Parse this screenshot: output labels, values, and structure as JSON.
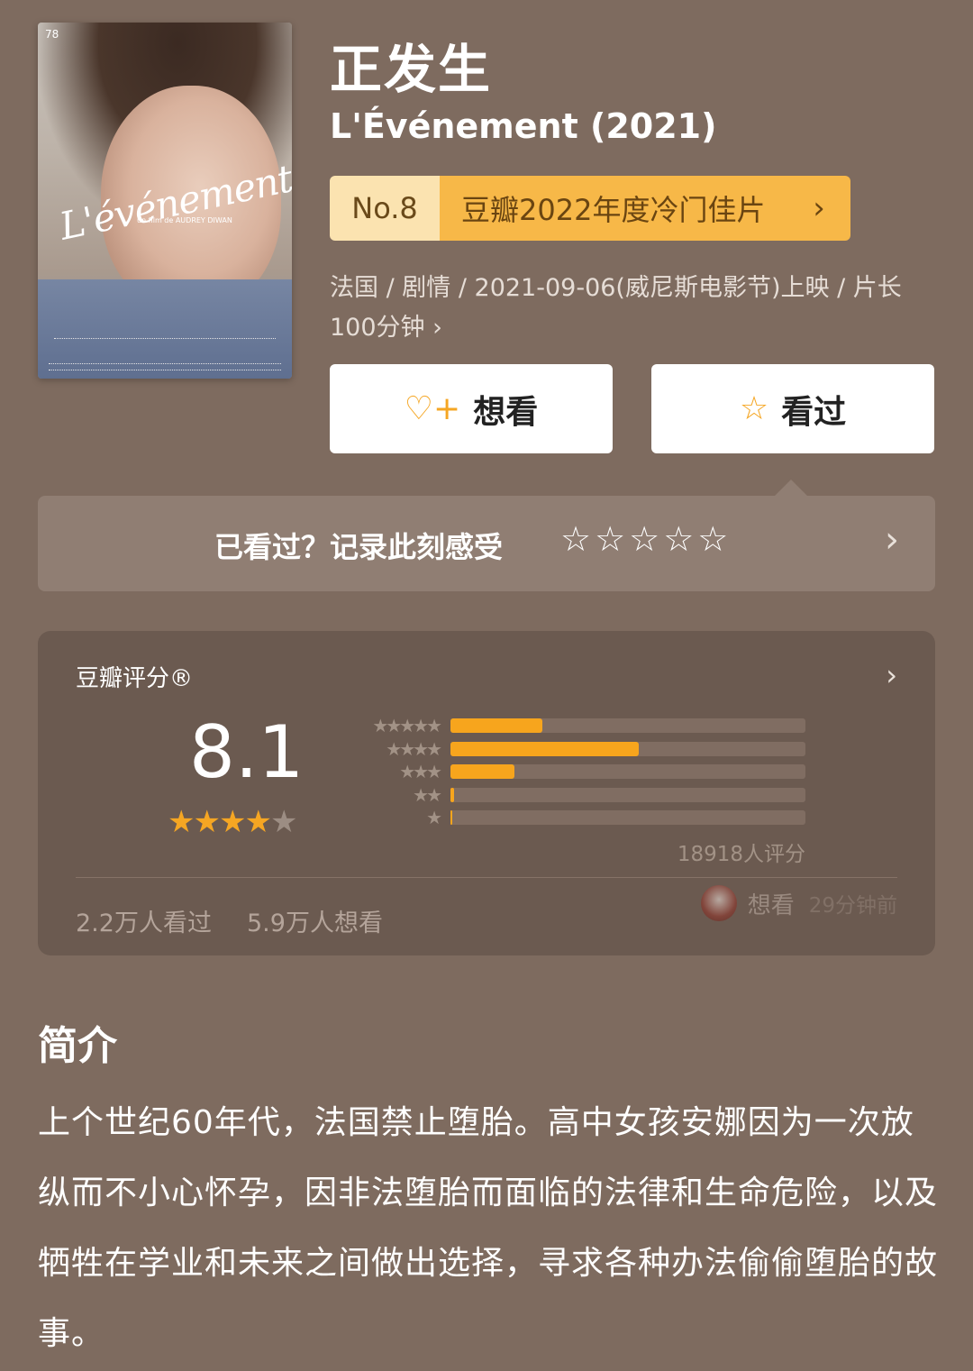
{
  "movie": {
    "title_cn": "正发生",
    "title_en": "L'Événement (2021)",
    "poster": {
      "script_title": "L'événement",
      "director_line": "un film de AUDREY DIWAN",
      "festival_mark": "78"
    },
    "rank": {
      "no": "No.8",
      "label": "豆瓣2022年度冷门佳片",
      "chevron": "›"
    },
    "meta_line1": "法国 / 剧情 / 2021-09-06(威尼斯电影节)上映 / 片长",
    "meta_line2": "100分钟 ›"
  },
  "actions": {
    "want": {
      "label": "想看",
      "icon": "heart-plus-icon",
      "glyph": "♡+"
    },
    "seen": {
      "label": "看过",
      "icon": "star-outline-icon",
      "glyph": "☆"
    }
  },
  "record": {
    "label": "已看过？记录此刻感受",
    "stars": "☆☆☆☆☆",
    "chevron": "›"
  },
  "rating": {
    "title": "豆瓣评分®",
    "chevron": "›",
    "score": "8.1",
    "stars": 4,
    "distribution": [
      {
        "stars": "★★★★★",
        "percent": 26
      },
      {
        "stars": "★★★★",
        "percent": 53
      },
      {
        "stars": "★★★",
        "percent": 18
      },
      {
        "stars": "★★",
        "percent": 1
      },
      {
        "stars": "★",
        "percent": 0.5
      }
    ],
    "count": "18918人评分",
    "seen_count": "2.2万人看过",
    "want_count": "5.9万人想看",
    "activity": {
      "verb": "想看",
      "time": "29分钟前"
    }
  },
  "intro": {
    "heading": "简介",
    "text": "上个世纪60年代，法国禁止堕胎。高中女孩安娜因为一次放纵而不小心怀孕，因非法堕胎而面临的法律和生命危险，以及牺牲在学业和未来之间做出选择，寻求各种办法偷偷堕胎的故事。"
  },
  "colors": {
    "background": "#7e6b5f",
    "accent": "#f5a623",
    "rank_bg": "#f7b848",
    "card": "#6b5a50"
  }
}
